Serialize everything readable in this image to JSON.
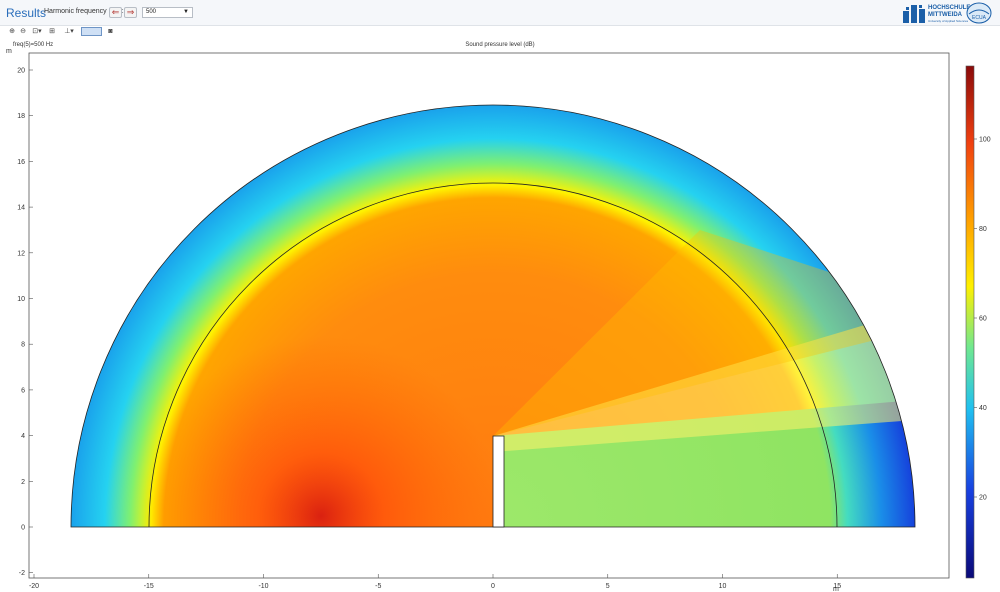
{
  "header": {
    "title": "Results",
    "parameter_label": "Harmonic frequency (Hz):",
    "prev_symbol": "⇐",
    "next_symbol": "⇒",
    "selected_value": "500"
  },
  "logos": {
    "hsmw_line1": "HOCHSCHULE",
    "hsmw_line2": "MITTWEIDA",
    "hsmw_tagline": "University of Applied Sciences",
    "ecua_label": "ECUA"
  },
  "toolbar": {
    "icons": [
      "zoom-in-icon",
      "zoom-out-icon",
      "zoom-box-icon",
      "zoom-extents-icon",
      "axis-icon",
      "graphics-view-icon",
      "camera-icon"
    ]
  },
  "plot": {
    "freq_readout": "freq(5)=500 Hz",
    "title": "Sound pressure level (dB)",
    "x_unit": "m",
    "y_unit": "m",
    "x_ticks": [
      "-20",
      "-15",
      "-10",
      "-5",
      "0",
      "5",
      "10",
      "15"
    ],
    "y_ticks": [
      "-2",
      "0",
      "2",
      "4",
      "6",
      "8",
      "10",
      "12",
      "14",
      "16",
      "18",
      "20"
    ],
    "colorbar_ticks": [
      "20",
      "40",
      "60",
      "80",
      "100"
    ]
  },
  "colors": {
    "accent": "#2a6ebb",
    "arrow": "#b2332e",
    "logo_blue": "#1b5fa8"
  }
}
